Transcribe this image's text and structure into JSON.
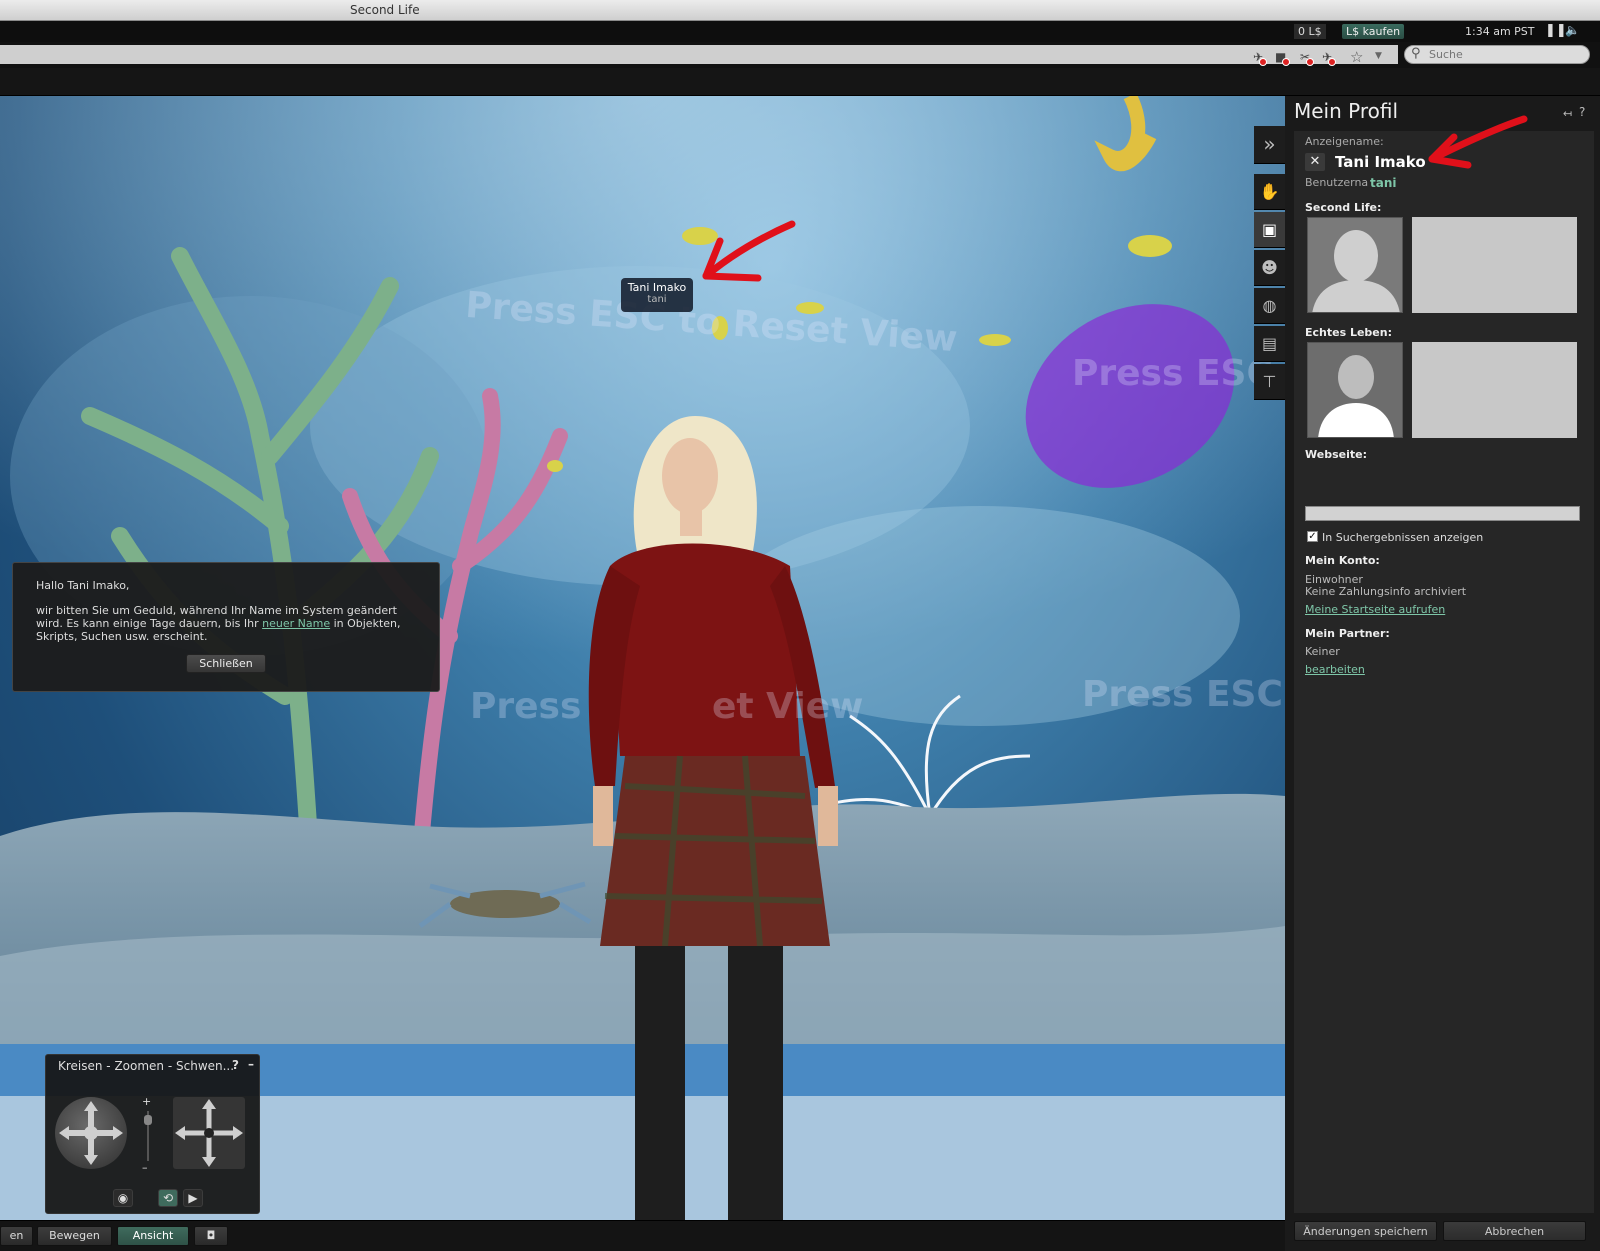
{
  "window": {
    "title": "Second Life"
  },
  "status": {
    "balance": "0 L$",
    "buy_label": "L$ kaufen",
    "time": "1:34 am PST",
    "pause_icon": "pause-icon",
    "volume_icon": "volume-icon"
  },
  "nav": {
    "search_placeholder": "Suche"
  },
  "scene": {
    "watermark": "Press ESC to Reset View",
    "watermark_fragments": [
      "Press ESC",
      "Press",
      "et View",
      "Press ESC t"
    ],
    "nametag": {
      "display_name": "Tani Imako",
      "username": "tani"
    }
  },
  "notice": {
    "greeting": "Hallo Tani Imako,",
    "body_part1": "wir bitten Sie um Geduld, während Ihr Name im System geändert wird. Es kann einige Tage dauern, bis Ihr ",
    "link_text": "neuer Name",
    "body_part2": " in Objekten, Skripts, Suchen usw. erscheint.",
    "close_label": "Schließen"
  },
  "camera": {
    "title": "Kreisen - Zoomen - Schwen...",
    "help": "?",
    "minimize": "–",
    "zoom_plus": "+",
    "zoom_minus": "–"
  },
  "toolbar": {
    "left_partial": "en",
    "move_label": "Bewegen",
    "view_label": "Ansicht",
    "snapshot_icon": "camera-icon"
  },
  "profile": {
    "title": "Mein Profil",
    "display_name_label": "Anzeigename:",
    "display_name": "Tani Imako",
    "username_label": "Benutzerna",
    "username": "tani",
    "second_life_label": "Second Life:",
    "real_life_label": "Echtes Leben:",
    "website_label": "Webseite:",
    "search_checkbox_label": "In Suchergebnissen anzeigen",
    "search_checked": true,
    "account_label": "Mein Konto:",
    "account_type": "Einwohner",
    "payment_info": "Keine Zahlungsinfo archiviert",
    "home_link": "Meine Startseite aufrufen",
    "partner_label": "Mein Partner:",
    "partner_value": "Keiner",
    "edit_link": "bearbeiten",
    "save_label": "Änderungen speichern",
    "cancel_label": "Abbrechen"
  },
  "colors": {
    "accent": "#3f6b5d",
    "link": "#7ec6a8",
    "annotation_arrow": "#e0101a"
  }
}
